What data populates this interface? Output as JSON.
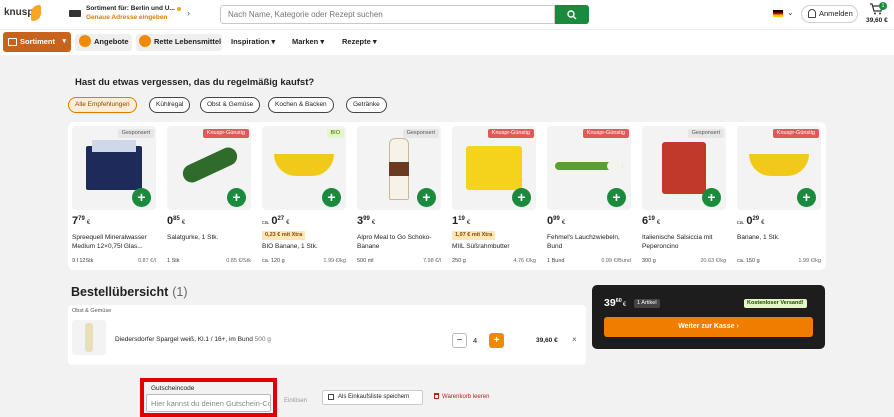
{
  "header": {
    "logo": "knuspr",
    "delivery_line1": "Sortiment für: Berlin und U...",
    "delivery_line2": "Genaue Adresse eingeben",
    "search_placeholder": "Nach Name, Kategorie oder Rezept suchen",
    "login_label": "Anmelden",
    "cart_count": "1",
    "cart_total": "39,60 €"
  },
  "nav": {
    "sortiment": "Sortiment",
    "items": [
      "Angebote",
      "Rette Lebensmittel",
      "Inspiration",
      "Marken",
      "Rezepte"
    ]
  },
  "recommendations": {
    "heading": "Hast du etwas vergessen, das du regelmäßig kaufst?",
    "chips": [
      "Alle Empfehlungen",
      "Kühlregal",
      "Obst & Gemüse",
      "Kochen & Backen",
      "Getränke"
    ],
    "products": [
      {
        "badge": "Gesponsert",
        "price_int": "7",
        "price_dec": "79",
        "currency": "€",
        "prefix": "",
        "promo": "",
        "name": "Spreequell Mineralwasser Medium 12×0,75l Glas...",
        "unit": "9 l 12Stk",
        "per_unit": "0.87 €/l"
      },
      {
        "badge": "Knuspr-Günstig",
        "price_int": "0",
        "price_dec": "85",
        "currency": "€",
        "prefix": "",
        "promo": "",
        "name": "Salatgurke, 1 Stk.",
        "unit": "1 Stk",
        "per_unit": "0.85 €/Stk"
      },
      {
        "badge": "BIO",
        "price_int": "0",
        "price_dec": "27",
        "currency": "€",
        "prefix": "ca.",
        "promo": "0,23 € mit Xtra",
        "name": "BIO Banane, 1 Stk.",
        "unit": "ca. 120 g",
        "per_unit": "1.99 €/kg"
      },
      {
        "badge": "Gesponsert",
        "price_int": "3",
        "price_dec": "99",
        "currency": "€",
        "prefix": "",
        "promo": "",
        "name": "Alpro Meal to Go Schoko-Banane",
        "unit": "500 ml",
        "per_unit": "7.98 €/l"
      },
      {
        "badge": "Knuspr-Günstig",
        "price_int": "1",
        "price_dec": "19",
        "currency": "€",
        "prefix": "",
        "promo": "1,07 € mit Xtra",
        "name": "MIIL Süßrahmbutter",
        "unit": "250 g",
        "per_unit": "4.76 €/kg"
      },
      {
        "badge": "Knuspr-Günstig",
        "price_int": "0",
        "price_dec": "99",
        "currency": "€",
        "prefix": "",
        "promo": "",
        "name": "Fehmel's Lauchzwiebeln, Bund",
        "unit": "1 Bund",
        "per_unit": "0.99 €/Bund"
      },
      {
        "badge": "Gesponsert",
        "price_int": "6",
        "price_dec": "19",
        "currency": "€",
        "prefix": "",
        "promo": "",
        "name": "Italienische Salsiccia mit Peperoncino",
        "unit": "300 g",
        "per_unit": "20.63 €/kg"
      },
      {
        "badge": "Knuspr-Günstig",
        "price_int": "0",
        "price_dec": "29",
        "currency": "€",
        "prefix": "ca.",
        "promo": "",
        "name": "Banane, 1 Stk.",
        "unit": "ca. 150 g",
        "per_unit": "1.99 €/kg"
      }
    ]
  },
  "order": {
    "title": "Bestellübersicht",
    "count": "(1)",
    "category": "Obst & Gemüse",
    "item_name": "Diedersdorfer Spargel weiß, Kl.1 / 16+, im Bund",
    "item_weight": "500 g",
    "quantity": "4",
    "item_price": "39,60 €"
  },
  "checkout": {
    "price_int": "39",
    "price_dec": "60",
    "currency": "€",
    "items_badge": "1 Artikel",
    "free_shipping": "Kostenloser Versand!",
    "button": "Weiter zur Kasse"
  },
  "voucher": {
    "label": "Gutscheincode",
    "placeholder": "Hier kannst du deinen Gutschein-Code eingeben",
    "redeem": "Einlösen"
  },
  "actions": {
    "save_list": "Als Einkaufsliste speichern",
    "clear_cart": "Warenkorb leeren"
  },
  "colors": {
    "brand_green": "#1a8a3c",
    "brand_orange": "#f07d00",
    "sortiment_bg": "#c8631c",
    "highlight_red": "#e00000"
  }
}
